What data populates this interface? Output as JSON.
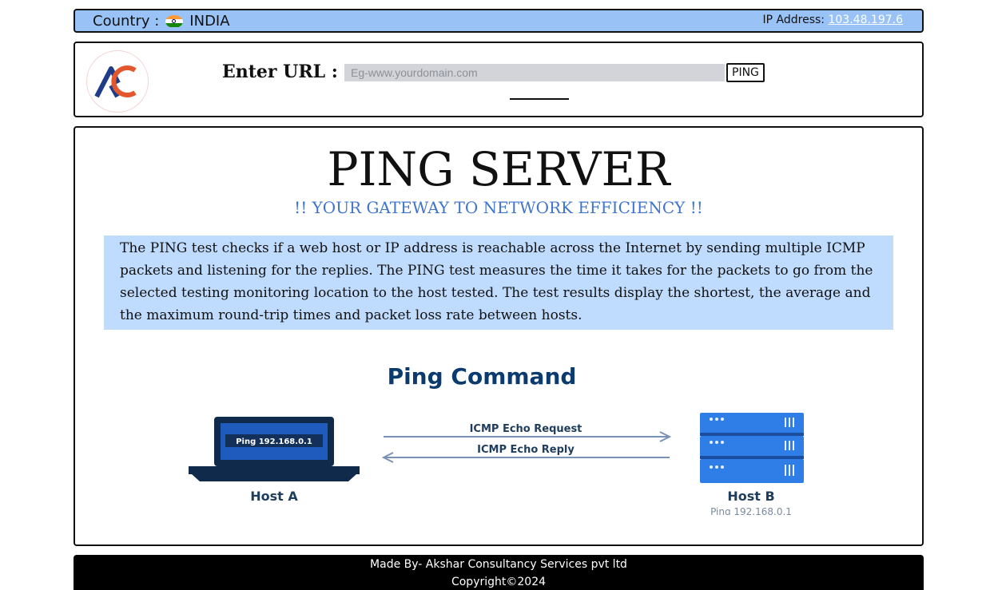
{
  "header": {
    "country_label": "Country :",
    "country_name": "INDIA",
    "ip_label": "IP Address:",
    "ip_value": "103.48.197.6"
  },
  "url_bar": {
    "label": "Enter URL :",
    "placeholder": "Eg-www.yourdomain.com",
    "button_label": "PING"
  },
  "main": {
    "title": "PING SERVER",
    "subtitle": "!! YOUR GATEWAY TO NETWORK EFFICIENCY !!",
    "description": "The PING test checks if a web host or IP address is reachable across the Internet by sending multiple ICMP packets and listening for the replies. The PING test measures the time it takes for the packets to go from the selected testing monitoring location to the host tested. The test results display the shortest, the average and the maximum round-trip times and packet loss rate between hosts."
  },
  "diagram": {
    "title": "Ping Command",
    "laptop_screen_text": "Ping 192.168.0.1",
    "request_label": "ICMP Echo Request",
    "reply_label": "ICMP Echo Reply",
    "host_a": "Host A",
    "host_b": "Host B",
    "host_b_caption": "Ping 192.168.0.1"
  },
  "footer": {
    "made_by": "Made By- Akshar Consultancy Services pvt ltd",
    "copyright": "Copyright©2024"
  },
  "colors": {
    "header_bg": "#99c3f7",
    "description_bg": "#bfdbfe",
    "subtitle": "#3f74cf",
    "diagram_title": "#0b3b6e"
  }
}
